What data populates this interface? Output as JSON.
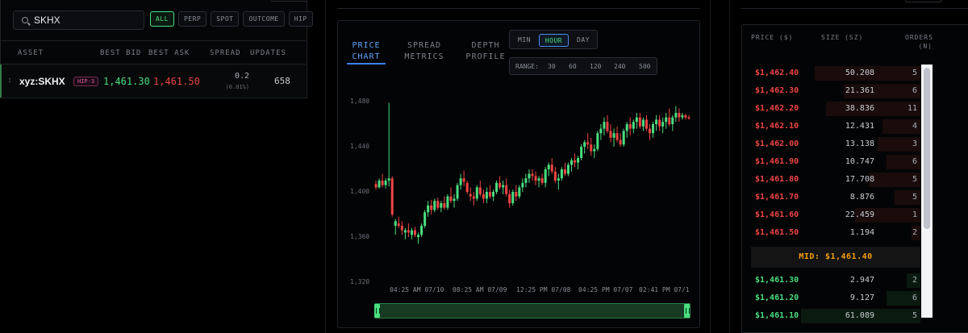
{
  "market_list": {
    "search_value": "SKHX",
    "filters": [
      {
        "label": "ALL",
        "active": true
      },
      {
        "label": "PERP",
        "active": false
      },
      {
        "label": "SPOT",
        "active": false
      },
      {
        "label": "OUTCOME",
        "active": false
      },
      {
        "label": "HIP",
        "active": false
      }
    ],
    "columns": [
      "ASSET",
      "BEST BID",
      "BEST ASK",
      "SPREAD",
      "UPDATES"
    ],
    "rows": [
      {
        "asset_prefix": ":",
        "asset": "xyz:SKHX",
        "badge": "HIP-3",
        "best_bid": "1,461.30",
        "best_ask": "1,461.50",
        "spread": "0.2",
        "spread_pct": "(0.01%)",
        "updates": "658"
      }
    ]
  },
  "chart_panel": {
    "tabs": [
      {
        "label": "PRICE\nCHART",
        "line1": "PRICE",
        "line2": "CHART",
        "active": true
      },
      {
        "label": "SPREAD\nMETRICS",
        "line1": "SPREAD",
        "line2": "METRICS",
        "active": false
      },
      {
        "label": "DEPTH\nPROFILE",
        "line1": "DEPTH",
        "line2": "PROFILE",
        "active": false
      }
    ],
    "intervals": [
      {
        "label": "MIN",
        "active": false
      },
      {
        "label": "HOUR",
        "active": true
      },
      {
        "label": "DAY",
        "active": false
      }
    ],
    "range_label": "RANGE:",
    "ranges": [
      "30",
      "60",
      "120",
      "240",
      "500"
    ],
    "y_ticks": [
      "1,480",
      "1,440",
      "1,400",
      "1,360",
      "1,320"
    ],
    "x_ticks": [
      "04:25 AM 07/10",
      "08:25 AM 07/09",
      "12:25 PM 07/08",
      "04:25 PM 07/07",
      "02:41 PM 07/1"
    ],
    "colors": {
      "up": "#4ade80",
      "down": "#ef4444"
    }
  },
  "chart_data": {
    "type": "candlestick",
    "ylim": [
      1320,
      1485
    ],
    "candles": [
      {
        "o": 1407,
        "h": 1410,
        "l": 1402,
        "c": 1404
      },
      {
        "o": 1404,
        "h": 1412,
        "l": 1403,
        "c": 1410
      },
      {
        "o": 1410,
        "h": 1416,
        "l": 1404,
        "c": 1406
      },
      {
        "o": 1406,
        "h": 1412,
        "l": 1403,
        "c": 1410
      },
      {
        "o": 1410,
        "h": 1479,
        "l": 1405,
        "c": 1412
      },
      {
        "o": 1412,
        "h": 1414,
        "l": 1378,
        "c": 1380
      },
      {
        "o": 1370,
        "h": 1376,
        "l": 1362,
        "c": 1374
      },
      {
        "o": 1372,
        "h": 1378,
        "l": 1368,
        "c": 1370
      },
      {
        "o": 1370,
        "h": 1374,
        "l": 1362,
        "c": 1366
      },
      {
        "o": 1364,
        "h": 1368,
        "l": 1358,
        "c": 1366
      },
      {
        "o": 1366,
        "h": 1372,
        "l": 1360,
        "c": 1364
      },
      {
        "o": 1362,
        "h": 1368,
        "l": 1358,
        "c": 1366
      },
      {
        "o": 1366,
        "h": 1369,
        "l": 1360,
        "c": 1362
      },
      {
        "o": 1360,
        "h": 1364,
        "l": 1354,
        "c": 1362
      },
      {
        "o": 1362,
        "h": 1372,
        "l": 1360,
        "c": 1370
      },
      {
        "o": 1370,
        "h": 1384,
        "l": 1368,
        "c": 1382
      },
      {
        "o": 1382,
        "h": 1392,
        "l": 1378,
        "c": 1388
      },
      {
        "o": 1388,
        "h": 1393,
        "l": 1380,
        "c": 1384
      },
      {
        "o": 1384,
        "h": 1394,
        "l": 1382,
        "c": 1392
      },
      {
        "o": 1392,
        "h": 1395,
        "l": 1384,
        "c": 1386
      },
      {
        "o": 1386,
        "h": 1392,
        "l": 1382,
        "c": 1390
      },
      {
        "o": 1390,
        "h": 1396,
        "l": 1384,
        "c": 1386
      },
      {
        "o": 1386,
        "h": 1398,
        "l": 1384,
        "c": 1396
      },
      {
        "o": 1396,
        "h": 1404,
        "l": 1390,
        "c": 1392
      },
      {
        "o": 1392,
        "h": 1398,
        "l": 1386,
        "c": 1394
      },
      {
        "o": 1394,
        "h": 1408,
        "l": 1392,
        "c": 1406
      },
      {
        "o": 1406,
        "h": 1416,
        "l": 1402,
        "c": 1412
      },
      {
        "o": 1412,
        "h": 1419,
        "l": 1405,
        "c": 1409
      },
      {
        "o": 1408,
        "h": 1410,
        "l": 1398,
        "c": 1400
      },
      {
        "o": 1398,
        "h": 1404,
        "l": 1392,
        "c": 1396
      },
      {
        "o": 1396,
        "h": 1400,
        "l": 1388,
        "c": 1394
      },
      {
        "o": 1394,
        "h": 1406,
        "l": 1392,
        "c": 1404
      },
      {
        "o": 1404,
        "h": 1410,
        "l": 1396,
        "c": 1398
      },
      {
        "o": 1398,
        "h": 1402,
        "l": 1390,
        "c": 1394
      },
      {
        "o": 1394,
        "h": 1404,
        "l": 1390,
        "c": 1400
      },
      {
        "o": 1400,
        "h": 1406,
        "l": 1394,
        "c": 1396
      },
      {
        "o": 1396,
        "h": 1402,
        "l": 1392,
        "c": 1400
      },
      {
        "o": 1400,
        "h": 1410,
        "l": 1398,
        "c": 1408
      },
      {
        "o": 1408,
        "h": 1414,
        "l": 1402,
        "c": 1404
      },
      {
        "o": 1404,
        "h": 1410,
        "l": 1398,
        "c": 1406
      },
      {
        "o": 1406,
        "h": 1412,
        "l": 1396,
        "c": 1398
      },
      {
        "o": 1398,
        "h": 1402,
        "l": 1386,
        "c": 1390
      },
      {
        "o": 1390,
        "h": 1402,
        "l": 1388,
        "c": 1400
      },
      {
        "o": 1400,
        "h": 1406,
        "l": 1392,
        "c": 1396
      },
      {
        "o": 1396,
        "h": 1406,
        "l": 1394,
        "c": 1404
      },
      {
        "o": 1404,
        "h": 1412,
        "l": 1400,
        "c": 1408
      },
      {
        "o": 1408,
        "h": 1416,
        "l": 1404,
        "c": 1412
      },
      {
        "o": 1412,
        "h": 1420,
        "l": 1408,
        "c": 1416
      },
      {
        "o": 1416,
        "h": 1420,
        "l": 1410,
        "c": 1414
      },
      {
        "o": 1414,
        "h": 1418,
        "l": 1406,
        "c": 1410
      },
      {
        "o": 1410,
        "h": 1414,
        "l": 1404,
        "c": 1412
      },
      {
        "o": 1412,
        "h": 1416,
        "l": 1406,
        "c": 1408
      },
      {
        "o": 1408,
        "h": 1422,
        "l": 1404,
        "c": 1420
      },
      {
        "o": 1420,
        "h": 1426,
        "l": 1414,
        "c": 1424
      },
      {
        "o": 1424,
        "h": 1430,
        "l": 1416,
        "c": 1418
      },
      {
        "o": 1418,
        "h": 1422,
        "l": 1408,
        "c": 1410
      },
      {
        "o": 1410,
        "h": 1416,
        "l": 1402,
        "c": 1412
      },
      {
        "o": 1412,
        "h": 1422,
        "l": 1410,
        "c": 1420
      },
      {
        "o": 1420,
        "h": 1426,
        "l": 1414,
        "c": 1416
      },
      {
        "o": 1416,
        "h": 1426,
        "l": 1414,
        "c": 1424
      },
      {
        "o": 1424,
        "h": 1430,
        "l": 1418,
        "c": 1428
      },
      {
        "o": 1428,
        "h": 1434,
        "l": 1422,
        "c": 1426
      },
      {
        "o": 1426,
        "h": 1432,
        "l": 1420,
        "c": 1430
      },
      {
        "o": 1430,
        "h": 1442,
        "l": 1428,
        "c": 1440
      },
      {
        "o": 1440,
        "h": 1446,
        "l": 1434,
        "c": 1444
      },
      {
        "o": 1444,
        "h": 1452,
        "l": 1438,
        "c": 1442
      },
      {
        "o": 1442,
        "h": 1448,
        "l": 1432,
        "c": 1436
      },
      {
        "o": 1436,
        "h": 1442,
        "l": 1430,
        "c": 1438
      },
      {
        "o": 1438,
        "h": 1454,
        "l": 1436,
        "c": 1452
      },
      {
        "o": 1452,
        "h": 1460,
        "l": 1446,
        "c": 1456
      },
      {
        "o": 1456,
        "h": 1466,
        "l": 1450,
        "c": 1462
      },
      {
        "o": 1462,
        "h": 1468,
        "l": 1452,
        "c": 1454
      },
      {
        "o": 1454,
        "h": 1460,
        "l": 1444,
        "c": 1448
      },
      {
        "o": 1448,
        "h": 1456,
        "l": 1440,
        "c": 1452
      },
      {
        "o": 1452,
        "h": 1458,
        "l": 1444,
        "c": 1446
      },
      {
        "o": 1446,
        "h": 1452,
        "l": 1440,
        "c": 1442
      },
      {
        "o": 1442,
        "h": 1456,
        "l": 1440,
        "c": 1454
      },
      {
        "o": 1454,
        "h": 1462,
        "l": 1448,
        "c": 1460
      },
      {
        "o": 1460,
        "h": 1466,
        "l": 1450,
        "c": 1456
      },
      {
        "o": 1456,
        "h": 1464,
        "l": 1452,
        "c": 1462
      },
      {
        "o": 1462,
        "h": 1470,
        "l": 1456,
        "c": 1466
      },
      {
        "o": 1466,
        "h": 1470,
        "l": 1456,
        "c": 1458
      },
      {
        "o": 1458,
        "h": 1466,
        "l": 1454,
        "c": 1464
      },
      {
        "o": 1464,
        "h": 1468,
        "l": 1454,
        "c": 1456
      },
      {
        "o": 1456,
        "h": 1460,
        "l": 1446,
        "c": 1452
      },
      {
        "o": 1452,
        "h": 1462,
        "l": 1448,
        "c": 1460
      },
      {
        "o": 1460,
        "h": 1468,
        "l": 1454,
        "c": 1464
      },
      {
        "o": 1464,
        "h": 1468,
        "l": 1454,
        "c": 1458
      },
      {
        "o": 1458,
        "h": 1466,
        "l": 1452,
        "c": 1462
      },
      {
        "o": 1462,
        "h": 1470,
        "l": 1456,
        "c": 1466
      },
      {
        "o": 1466,
        "h": 1474,
        "l": 1458,
        "c": 1460
      },
      {
        "o": 1460,
        "h": 1468,
        "l": 1454,
        "c": 1466
      },
      {
        "o": 1466,
        "h": 1476,
        "l": 1462,
        "c": 1470
      },
      {
        "o": 1470,
        "h": 1474,
        "l": 1462,
        "c": 1466
      },
      {
        "o": 1466,
        "h": 1470,
        "l": 1464,
        "c": 1468
      },
      {
        "o": 1468,
        "h": 1469,
        "l": 1464,
        "c": 1466
      },
      {
        "o": 1466,
        "h": 1468,
        "l": 1464,
        "c": 1465
      }
    ]
  },
  "order_book": {
    "columns": [
      {
        "line1": "PRICE ($)",
        "line2": ""
      },
      {
        "line1": "SIZE (SZ)",
        "line2": ""
      },
      {
        "line1": "ORDERS",
        "line2": "(N)"
      }
    ],
    "asks": [
      {
        "price": "$1,462.40",
        "size": "50.208",
        "orders": "5",
        "depth": 0.62
      },
      {
        "price": "$1,462.30",
        "size": "21.361",
        "orders": "6",
        "depth": 0.45
      },
      {
        "price": "$1,462.20",
        "size": "38.836",
        "orders": "11",
        "depth": 0.55
      },
      {
        "price": "$1,462.10",
        "size": "12.431",
        "orders": "4",
        "depth": 0.22
      },
      {
        "price": "$1,462.00",
        "size": "13.138",
        "orders": "3",
        "depth": 0.25
      },
      {
        "price": "$1,461.90",
        "size": "10.747",
        "orders": "6",
        "depth": 0.2
      },
      {
        "price": "$1,461.80",
        "size": "17.708",
        "orders": "5",
        "depth": 0.3
      },
      {
        "price": "$1,461.70",
        "size": "8.876",
        "orders": "5",
        "depth": 0.15
      },
      {
        "price": "$1,461.60",
        "size": "22.459",
        "orders": "1",
        "depth": 0.38
      },
      {
        "price": "$1,461.50",
        "size": "1.194",
        "orders": "2",
        "depth": 0.05
      }
    ],
    "mid_label": "MID: $1,461.40",
    "bids": [
      {
        "price": "$1,461.30",
        "size": "2.947",
        "orders": "2",
        "depth": 0.08
      },
      {
        "price": "$1,461.20",
        "size": "9.127",
        "orders": "6",
        "depth": 0.2
      },
      {
        "price": "$1,461.10",
        "size": "61.089",
        "orders": "5",
        "depth": 0.7
      }
    ]
  }
}
